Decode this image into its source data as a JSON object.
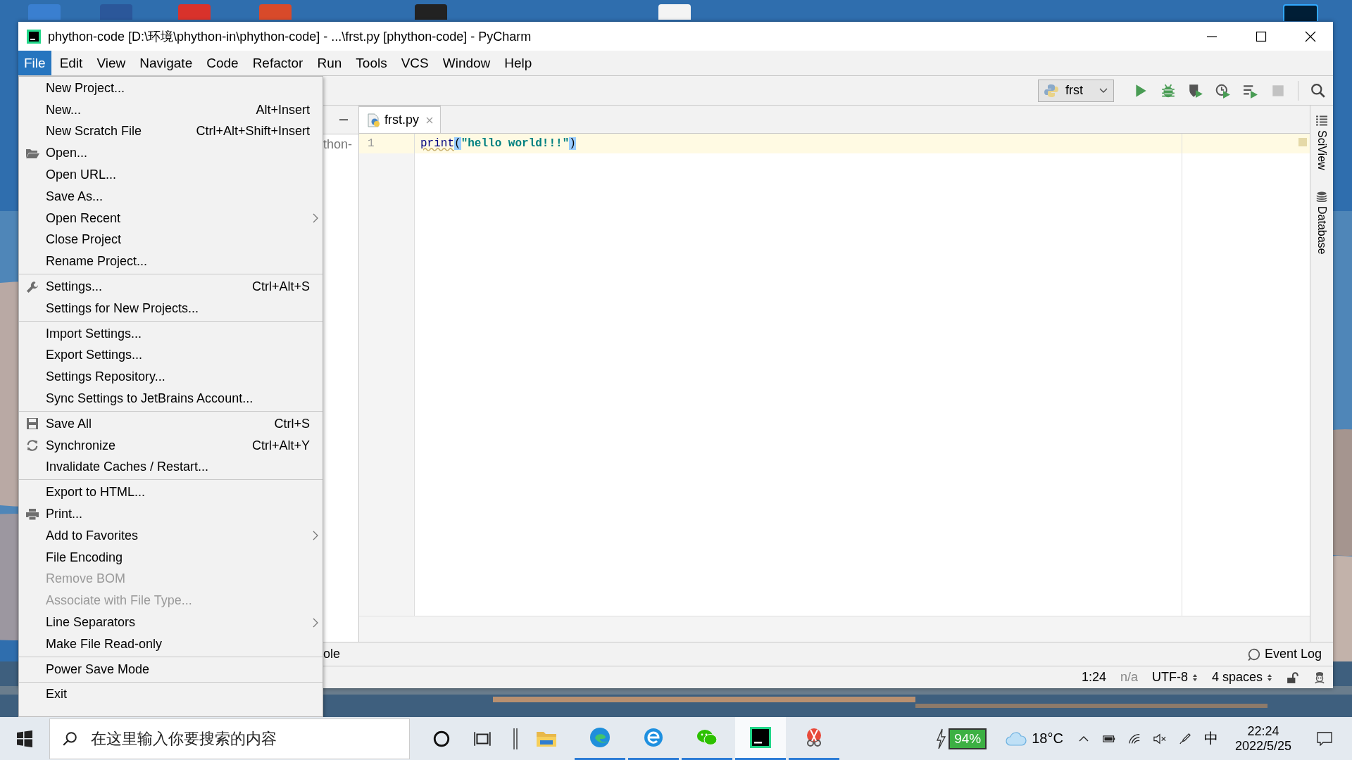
{
  "window": {
    "title": "phython-code [D:\\环境\\phython-in\\phython-code] - ...\\frst.py [phython-code] - PyCharm"
  },
  "menubar": [
    {
      "label": "File",
      "selected": true
    },
    {
      "label": "Edit",
      "selected": false
    },
    {
      "label": "View",
      "selected": false
    },
    {
      "label": "Navigate",
      "selected": false
    },
    {
      "label": "Code",
      "selected": false
    },
    {
      "label": "Refactor",
      "selected": false
    },
    {
      "label": "Run",
      "selected": false
    },
    {
      "label": "Tools",
      "selected": false
    },
    {
      "label": "VCS",
      "selected": false
    },
    {
      "label": "Window",
      "selected": false
    },
    {
      "label": "Help",
      "selected": false
    }
  ],
  "file_menu": {
    "groups": [
      {
        "items": [
          {
            "label": "New Project...",
            "submenu": false,
            "disabled": false
          },
          {
            "label": "New...",
            "shortcut": "Alt+Insert",
            "submenu": false,
            "disabled": false
          },
          {
            "label": "New Scratch File",
            "shortcut": "Ctrl+Alt+Shift+Insert",
            "submenu": false,
            "disabled": false
          },
          {
            "label": "Open...",
            "kind": "folder",
            "submenu": false,
            "disabled": false
          },
          {
            "label": "Open URL...",
            "submenu": false,
            "disabled": false
          },
          {
            "label": "Save As...",
            "submenu": false,
            "disabled": false
          },
          {
            "label": "Open Recent",
            "submenu": true,
            "disabled": false
          },
          {
            "label": "Close Project",
            "submenu": false,
            "disabled": false
          },
          {
            "label": "Rename Project...",
            "submenu": false,
            "disabled": false
          }
        ]
      },
      {
        "items": [
          {
            "label": "Settings...",
            "shortcut": "Ctrl+Alt+S",
            "kind": "wrench",
            "submenu": false,
            "disabled": false
          },
          {
            "label": "Settings for New Projects...",
            "submenu": false,
            "disabled": false
          }
        ]
      },
      {
        "items": [
          {
            "label": "Import Settings...",
            "submenu": false,
            "disabled": false
          },
          {
            "label": "Export Settings...",
            "submenu": false,
            "disabled": false
          },
          {
            "label": "Settings Repository...",
            "submenu": false,
            "disabled": false
          },
          {
            "label": "Sync Settings to JetBrains Account...",
            "submenu": false,
            "disabled": false
          }
        ]
      },
      {
        "items": [
          {
            "label": "Save All",
            "shortcut": "Ctrl+S",
            "kind": "save",
            "submenu": false,
            "disabled": false
          },
          {
            "label": "Synchronize",
            "shortcut": "Ctrl+Alt+Y",
            "kind": "sync",
            "submenu": false,
            "disabled": false
          },
          {
            "label": "Invalidate Caches / Restart...",
            "submenu": false,
            "disabled": false
          }
        ]
      },
      {
        "items": [
          {
            "label": "Export to HTML...",
            "submenu": false,
            "disabled": false
          },
          {
            "label": "Print...",
            "kind": "print",
            "submenu": false,
            "disabled": false
          },
          {
            "label": "Add to Favorites",
            "submenu": true,
            "disabled": false
          },
          {
            "label": "File Encoding",
            "submenu": false,
            "disabled": false
          },
          {
            "label": "Remove BOM",
            "submenu": false,
            "disabled": true
          },
          {
            "label": "Associate with File Type...",
            "submenu": false,
            "disabled": true
          },
          {
            "label": "Line Separators",
            "submenu": true,
            "disabled": false
          },
          {
            "label": "Make File Read-only",
            "submenu": false,
            "disabled": false
          }
        ]
      },
      {
        "items": [
          {
            "label": "Power Save Mode",
            "submenu": false,
            "disabled": false
          }
        ]
      },
      {
        "items": [
          {
            "label": "Exit",
            "submenu": false,
            "disabled": false
          }
        ]
      }
    ]
  },
  "toolbar": {
    "run_config": "frst"
  },
  "project_panel": {
    "visible_text": "thon-"
  },
  "editor": {
    "tab": {
      "label": "frst.py"
    },
    "lines": [
      {
        "number": "1",
        "tokens": [
          {
            "kind": "func",
            "text": "print"
          },
          {
            "kind": "paren",
            "text": "("
          },
          {
            "kind": "string",
            "text": "\"hello world!!!\""
          },
          {
            "kind": "paren",
            "text": ")"
          }
        ]
      }
    ]
  },
  "right_tools": [
    {
      "kind": "grid",
      "label": "SciView"
    },
    {
      "kind": "database",
      "label": "Database"
    }
  ],
  "bottom_bar": {
    "visible_text": "ole",
    "event_log": "Event Log"
  },
  "status_bar": {
    "position": "1:24",
    "context": "n/a",
    "encoding": "UTF-8",
    "indent": "4 spaces"
  },
  "taskbar": {
    "search_placeholder": "在这里输入你要搜索的内容",
    "apps": [
      {
        "kind": "folder",
        "running": false,
        "selected": false
      },
      {
        "kind": "edge",
        "running": true,
        "selected": false
      },
      {
        "kind": "browser",
        "running": true,
        "selected": false
      },
      {
        "kind": "chat",
        "running": true,
        "selected": false
      },
      {
        "kind": "ide",
        "running": true,
        "selected": true
      },
      {
        "kind": "snip",
        "running": true,
        "selected": false
      }
    ],
    "battery": "94%",
    "weather": "18°C",
    "ime": "中",
    "time": "22:24",
    "date": "2022/5/25"
  }
}
